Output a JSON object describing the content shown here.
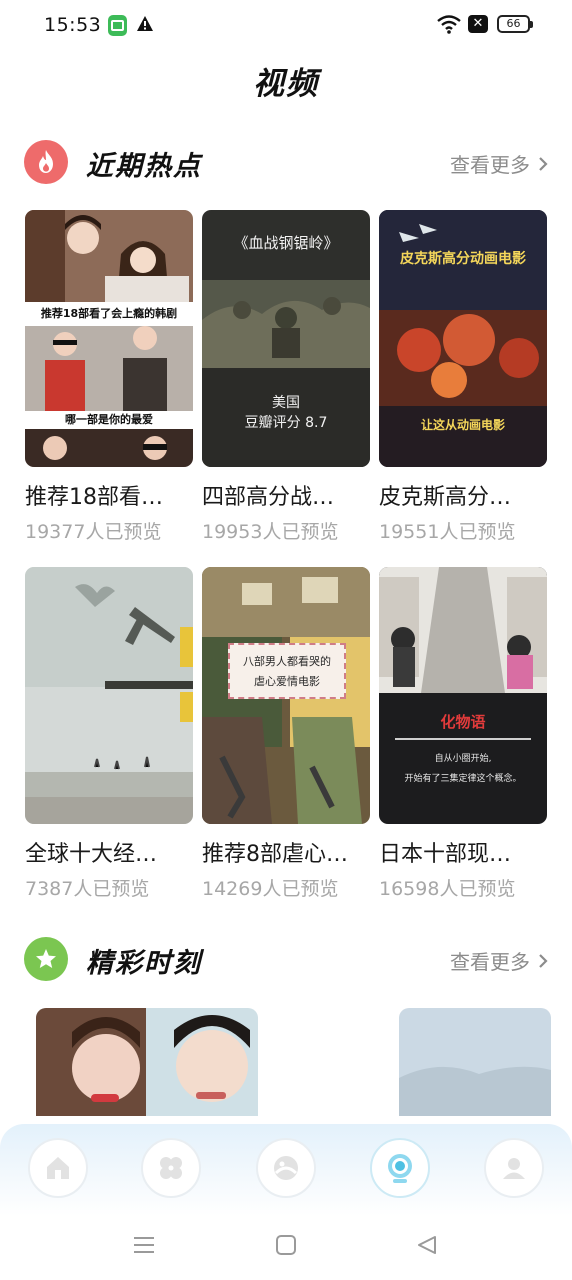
{
  "status_bar": {
    "time": "15:53",
    "battery": "66",
    "icons": [
      "app-notification-icon",
      "warning-icon",
      "wifi-icon",
      "x-icon",
      "battery-icon"
    ]
  },
  "page": {
    "title": "视频"
  },
  "hot_section": {
    "title": "近期热点",
    "more_label": "查看更多",
    "icon": "fire-icon",
    "icon_color": "#ee6b6b",
    "cards": [
      {
        "title": "推荐18部看…",
        "views": "19377人已预览",
        "overlay_top": "推荐18部看了会上瘾的韩剧",
        "overlay_bottom": "哪一部是你的最爱"
      },
      {
        "title": "四部高分战…",
        "views": "19953人已预览",
        "overlay_top": "《血战钢锯岭》",
        "overlay_bottom": "美国",
        "overlay_extra": "豆瓣评分 8.7"
      },
      {
        "title": "皮克斯高分…",
        "views": "19551人已预览",
        "overlay_top": "皮克斯高分动画电影",
        "overlay_bottom": "让这从动画电影"
      },
      {
        "title": "全球十大经…",
        "views": "7387人已预览"
      },
      {
        "title": "推荐8部虐心…",
        "views": "14269人已预览",
        "overlay_top": "八部男人都看哭的",
        "overlay_bottom": "虐心爱情电影"
      },
      {
        "title": "日本十部现…",
        "views": "16598人已预览",
        "overlay_top": "化物语",
        "overlay_bottom": "自从小圈开始,",
        "overlay_extra": "开始有了三集定律这个概念。"
      }
    ]
  },
  "moments_section": {
    "title": "精彩时刻",
    "more_label": "查看更多",
    "icon": "star-icon",
    "icon_color": "#7bc651"
  },
  "bottom_nav": {
    "items": [
      "home-icon",
      "apps-icon",
      "discover-icon",
      "video-icon",
      "profile-icon"
    ],
    "active": "video-icon",
    "accent": "#5fc3e4"
  },
  "system_nav": [
    "menu-icon",
    "home-square-icon",
    "back-icon"
  ]
}
